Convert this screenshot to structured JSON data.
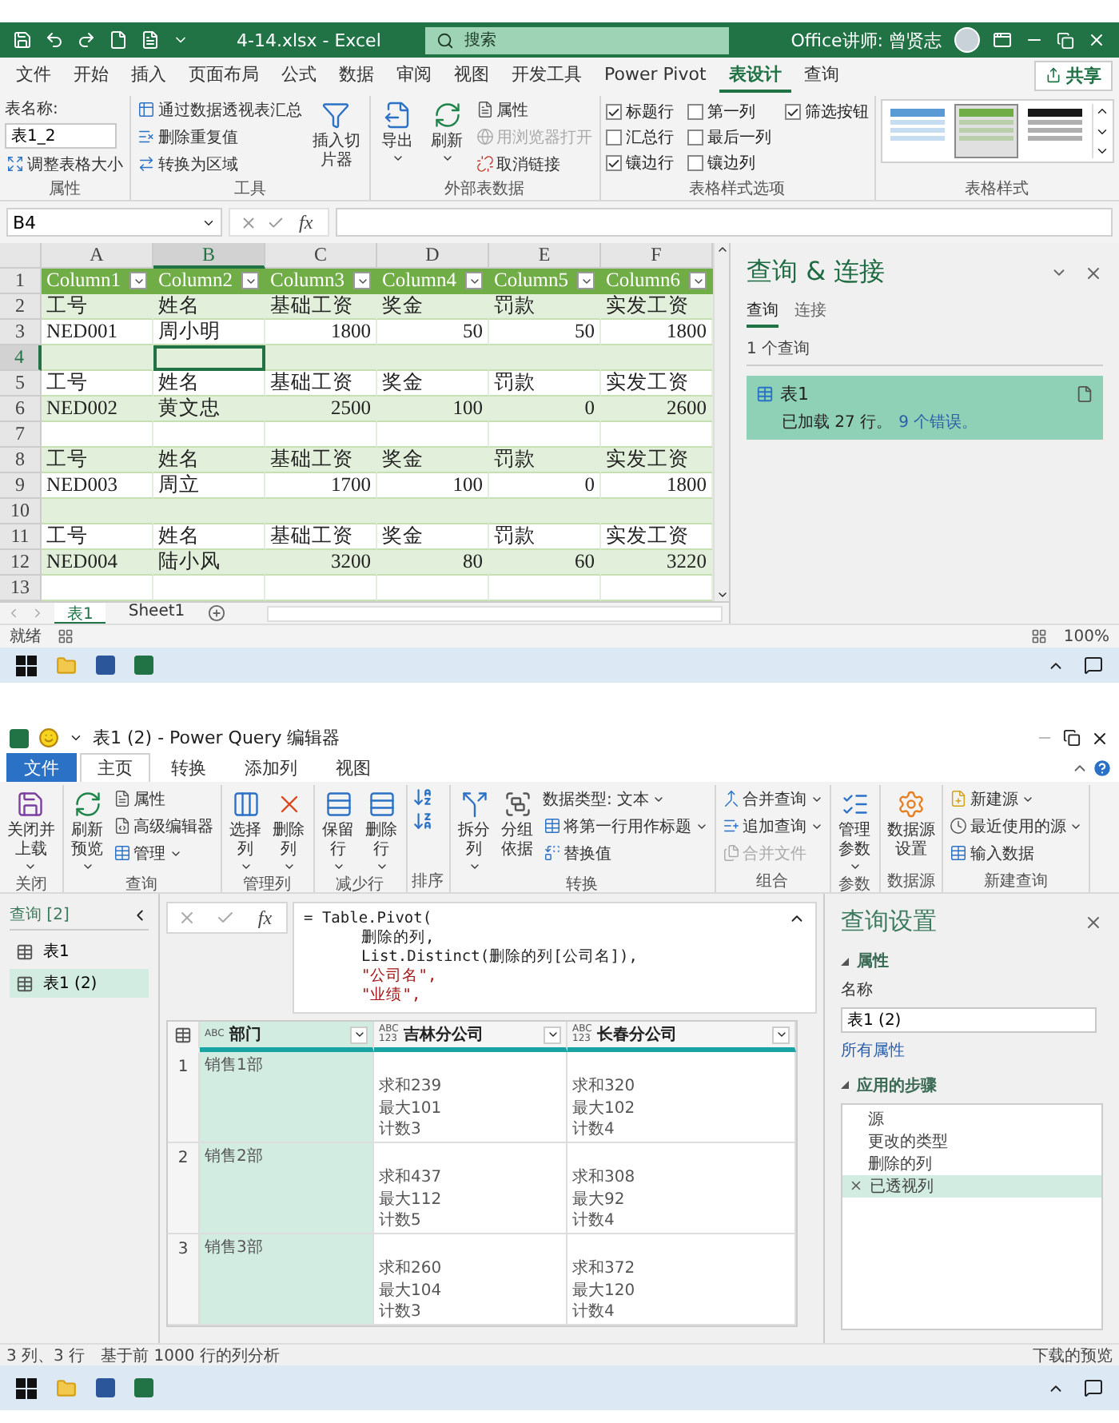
{
  "excel": {
    "title_bar": {
      "document": "4-14.xlsx  -  Excel",
      "search_placeholder": "搜索",
      "user": "Office讲师: 曾贤志"
    },
    "tabs": [
      {
        "label": "文件",
        "selected": false
      },
      {
        "label": "开始",
        "selected": false
      },
      {
        "label": "插入",
        "selected": false
      },
      {
        "label": "页面布局",
        "selected": false
      },
      {
        "label": "公式",
        "selected": false
      },
      {
        "label": "数据",
        "selected": false
      },
      {
        "label": "审阅",
        "selected": false
      },
      {
        "label": "视图",
        "selected": false
      },
      {
        "label": "开发工具",
        "selected": false
      },
      {
        "label": "Power Pivot",
        "selected": false
      },
      {
        "label": "表设计",
        "selected": true
      },
      {
        "label": "查询",
        "selected": false
      }
    ],
    "share_button": "共享",
    "ribbon_groups": [
      {
        "kind": "table_name",
        "title": "属性",
        "field_label": "表名称:",
        "field_value": "表1_2",
        "button": "调整表格大小"
      },
      {
        "kind": "buttons",
        "title": "工具",
        "columns": [
          {
            "kind": "stack",
            "items": [
              {
                "label": "通过数据透视表汇总",
                "dropdown": false,
                "disabled": false
              },
              {
                "label": "删除重复值",
                "dropdown": false,
                "disabled": false
              },
              {
                "label": "转换为区域",
                "dropdown": false,
                "disabled": false
              }
            ]
          },
          {
            "kind": "large",
            "label": "插入切片器",
            "dropdown": false
          }
        ]
      },
      {
        "kind": "buttons",
        "title": "外部表数据",
        "columns": [
          {
            "kind": "large",
            "label": "导出",
            "dropdown": true
          },
          {
            "kind": "large",
            "label": "刷新",
            "dropdown": true
          },
          {
            "kind": "stack",
            "items": [
              {
                "label": "属性",
                "dropdown": false,
                "disabled": false
              },
              {
                "label": "用浏览器打开",
                "dropdown": false,
                "disabled": true
              },
              {
                "label": "取消链接",
                "dropdown": false,
                "disabled": false
              }
            ]
          }
        ]
      },
      {
        "kind": "checks",
        "title": "表格样式选项",
        "options": [
          {
            "label": "标题行",
            "checked": true
          },
          {
            "label": "汇总行",
            "checked": false
          },
          {
            "label": "镶边行",
            "checked": true
          },
          {
            "label": "第一列",
            "checked": false
          },
          {
            "label": "最后一列",
            "checked": false
          },
          {
            "label": "镶边列",
            "checked": false
          },
          {
            "label": "筛选按钮",
            "checked": true
          }
        ]
      },
      {
        "kind": "gallery",
        "title": "表格样式",
        "styles": [
          {
            "selected": false,
            "color": "#5b9bd5"
          },
          {
            "selected": true,
            "color": "#70ad47"
          },
          {
            "selected": false,
            "color": "#1a1a1a"
          }
        ]
      }
    ],
    "formula_bar": {
      "name_box": "B4",
      "fx_label": "fx"
    },
    "sheet": {
      "banded_rows": true,
      "columns": [
        {
          "label": "A",
          "selected": false
        },
        {
          "label": "B",
          "selected": true
        },
        {
          "label": "C",
          "selected": false
        },
        {
          "label": "D",
          "selected": false
        },
        {
          "label": "E",
          "selected": false
        },
        {
          "label": "F",
          "selected": false
        }
      ],
      "rows": [
        {
          "number": "1",
          "selected": false,
          "kind": "table_header",
          "cells": [
            "Column1",
            "Column2",
            "Column3",
            "Column4",
            "Column5",
            "Column6"
          ]
        },
        {
          "number": "2",
          "selected": false,
          "kind": "label",
          "cells": [
            "工号",
            "姓名",
            "基础工资",
            "奖金",
            "罚款",
            "实发工资"
          ]
        },
        {
          "number": "3",
          "selected": false,
          "kind": "data",
          "cells": [
            "NED001",
            "周小明",
            "1800",
            "50",
            "50",
            "1800"
          ]
        },
        {
          "number": "4",
          "selected": true,
          "kind": "empty"
        },
        {
          "number": "5",
          "selected": false,
          "kind": "label",
          "cells": [
            "工号",
            "姓名",
            "基础工资",
            "奖金",
            "罚款",
            "实发工资"
          ]
        },
        {
          "number": "6",
          "selected": false,
          "kind": "data",
          "cells": [
            "NED002",
            "黄文忠",
            "2500",
            "100",
            "0",
            "2600"
          ]
        },
        {
          "number": "7",
          "selected": false,
          "kind": "empty"
        },
        {
          "number": "8",
          "selected": false,
          "kind": "label",
          "cells": [
            "工号",
            "姓名",
            "基础工资",
            "奖金",
            "罚款",
            "实发工资"
          ]
        },
        {
          "number": "9",
          "selected": false,
          "kind": "data",
          "cells": [
            "NED003",
            "周立",
            "1700",
            "100",
            "0",
            "1800"
          ]
        },
        {
          "number": "10",
          "selected": false,
          "kind": "empty"
        },
        {
          "number": "11",
          "selected": false,
          "kind": "label",
          "cells": [
            "工号",
            "姓名",
            "基础工资",
            "奖金",
            "罚款",
            "实发工资"
          ]
        },
        {
          "number": "12",
          "selected": false,
          "kind": "data",
          "cells": [
            "NED004",
            "陆小风",
            "3200",
            "80",
            "60",
            "3220"
          ]
        },
        {
          "number": "13",
          "selected": false,
          "kind": "empty"
        }
      ]
    },
    "sheet_tabs": [
      {
        "label": "表1",
        "selected": true
      },
      {
        "label": "Sheet1",
        "selected": false
      }
    ],
    "status_bar": {
      "mode": "就绪",
      "zoom": "100%"
    },
    "query_pane": {
      "title": "查询 & 连接",
      "tabs": [
        {
          "label": "查询",
          "selected": true
        },
        {
          "label": "连接",
          "selected": false
        }
      ],
      "count": "1 个查询",
      "queries": [
        {
          "name": "表1",
          "status": "已加载 27 行。",
          "errors": "9 个错误。"
        }
      ]
    }
  },
  "power_query": {
    "title": "表1 (2) - Power Query 编辑器",
    "tabs": [
      {
        "label": "文件",
        "kind": "file",
        "selected": false
      },
      {
        "label": "主页",
        "kind": "tab",
        "selected": true
      },
      {
        "label": "转换",
        "kind": "tab",
        "selected": false
      },
      {
        "label": "添加列",
        "kind": "tab",
        "selected": false
      },
      {
        "label": "视图",
        "kind": "tab",
        "selected": false
      }
    ],
    "ribbon_groups": [
      {
        "kind": "buttons",
        "title": "关闭",
        "columns": [
          {
            "kind": "large",
            "label": "关闭并上载",
            "dropdown": true
          }
        ]
      },
      {
        "kind": "buttons",
        "title": "查询",
        "columns": [
          {
            "kind": "large",
            "label": "刷新预览",
            "dropdown": true
          },
          {
            "kind": "stack",
            "items": [
              {
                "label": "属性",
                "dropdown": false,
                "disabled": false
              },
              {
                "label": "高级编辑器",
                "dropdown": false,
                "disabled": false
              },
              {
                "label": "管理",
                "dropdown": true,
                "disabled": false
              }
            ]
          }
        ]
      },
      {
        "kind": "buttons",
        "title": "管理列",
        "columns": [
          {
            "kind": "large",
            "label": "选择列",
            "dropdown": true
          },
          {
            "kind": "large",
            "label": "删除列",
            "dropdown": true
          }
        ]
      },
      {
        "kind": "buttons",
        "title": "减少行",
        "columns": [
          {
            "kind": "large",
            "label": "保留行",
            "dropdown": true
          },
          {
            "kind": "large",
            "label": "删除行",
            "dropdown": true
          }
        ]
      },
      {
        "kind": "buttons",
        "title": "排序",
        "columns": [
          {
            "kind": "sort"
          }
        ]
      },
      {
        "kind": "buttons",
        "title": "转换",
        "columns": [
          {
            "kind": "large",
            "label": "拆分列",
            "dropdown": true
          },
          {
            "kind": "large",
            "label": "分组依据",
            "dropdown": false
          },
          {
            "kind": "stack",
            "items": [
              {
                "label": "数据类型: 文本",
                "dropdown": true,
                "disabled": false
              },
              {
                "label": "将第一行用作标题",
                "dropdown": true,
                "disabled": false
              },
              {
                "label": "替换值",
                "dropdown": false,
                "disabled": false
              }
            ]
          }
        ]
      },
      {
        "kind": "buttons",
        "title": "组合",
        "columns": [
          {
            "kind": "stack",
            "items": [
              {
                "label": "合并查询",
                "dropdown": true,
                "disabled": false
              },
              {
                "label": "追加查询",
                "dropdown": true,
                "disabled": false
              },
              {
                "label": "合并文件",
                "dropdown": false,
                "disabled": true
              }
            ]
          }
        ]
      },
      {
        "kind": "buttons",
        "title": "参数",
        "columns": [
          {
            "kind": "large",
            "label": "管理参数",
            "dropdown": true
          }
        ]
      },
      {
        "kind": "buttons",
        "title": "数据源",
        "columns": [
          {
            "kind": "large",
            "label": "数据源设置",
            "dropdown": false
          }
        ]
      },
      {
        "kind": "buttons",
        "title": "新建查询",
        "columns": [
          {
            "kind": "stack",
            "items": [
              {
                "label": "新建源",
                "dropdown": true,
                "disabled": false
              },
              {
                "label": "最近使用的源",
                "dropdown": true,
                "disabled": false
              },
              {
                "label": "输入数据",
                "dropdown": false,
                "disabled": false
              }
            ]
          }
        ]
      }
    ],
    "queries_pane": {
      "title": "查询 [2]",
      "items": [
        {
          "name": "表1",
          "selected": false
        },
        {
          "name": "表1 (2)",
          "selected": true
        }
      ]
    },
    "formula_bar": {
      "fx_label": "fx",
      "lines": [
        {
          "kind": "code",
          "indented": false,
          "text": "= Table.Pivot("
        },
        {
          "kind": "code",
          "indented": true,
          "text": "删除的列,"
        },
        {
          "kind": "code",
          "indented": true,
          "text": "List.Distinct(删除的列[公司名]),"
        },
        {
          "kind": "string",
          "indented": true,
          "text": "\"公司名\","
        },
        {
          "kind": "string",
          "indented": true,
          "text": "\"业绩\","
        }
      ]
    },
    "table": {
      "columns": [
        {
          "name": "部门",
          "type_label": "ABC",
          "selected": true
        },
        {
          "name": "吉林分公司",
          "type_label": "ABC\n123",
          "selected": false
        },
        {
          "name": "长春分公司",
          "type_label": "ABC\n123",
          "selected": false
        }
      ],
      "rows": [
        {
          "number": "1",
          "cells": [
            "销售1部",
            "求和239\n最大101\n计数3",
            "求和320\n最大102\n计数4"
          ]
        },
        {
          "number": "2",
          "cells": [
            "销售2部",
            "求和437\n最大112\n计数5",
            "求和308\n最大92\n计数4"
          ]
        },
        {
          "number": "3",
          "cells": [
            "销售3部",
            "求和260\n最大104\n计数3",
            "求和372\n最大120\n计数4"
          ]
        }
      ]
    },
    "settings": {
      "title": "查询设置",
      "properties_heading": "属性",
      "name_label": "名称",
      "name_value": "表1 (2)",
      "all_properties": "所有属性",
      "steps_heading": "应用的步骤",
      "steps": [
        {
          "name": "源",
          "selected": false
        },
        {
          "name": "更改的类型",
          "selected": false
        },
        {
          "name": "删除的列",
          "selected": false
        },
        {
          "name": "已透视列",
          "selected": true
        }
      ]
    },
    "status_bar": {
      "shape": "3 列、3 行",
      "profiling": "基于前 1000 行的列分析",
      "preview": "下载的预览"
    }
  }
}
